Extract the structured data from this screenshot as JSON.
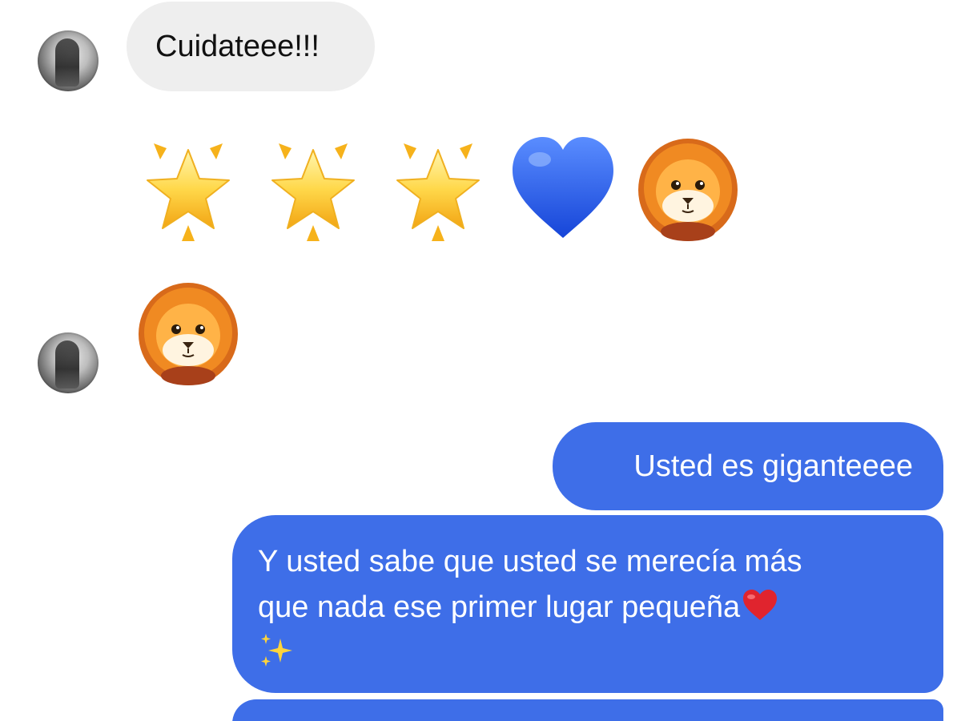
{
  "conversation": {
    "messages": [
      {
        "sender": "contact",
        "text": "Cuidateee!!!"
      },
      {
        "sender": "contact",
        "emojis": [
          "glowing-star",
          "glowing-star",
          "glowing-star",
          "blue-heart",
          "lion-face"
        ]
      },
      {
        "sender": "contact",
        "emojis": [
          "lion-face"
        ]
      },
      {
        "sender": "me",
        "text": "Usted es giganteeee"
      },
      {
        "sender": "me",
        "line1": "Y usted sabe que usted se merecía más",
        "line2": "que nada ese primer lugar pequeña",
        "trailing_emojis": [
          "red-heart",
          "sparkles"
        ]
      }
    ]
  },
  "colors": {
    "incoming_bubble": "#eeeeee",
    "outgoing_bubble": "#3e6ee8",
    "text_dark": "#111111",
    "text_light": "#ffffff"
  }
}
